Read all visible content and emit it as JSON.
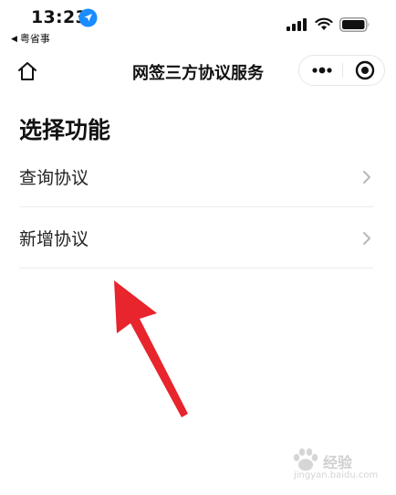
{
  "status_bar": {
    "time": "13:23",
    "back_app_label": "粤省事",
    "icons": [
      "location-arrow-icon",
      "cellular-signal-icon",
      "wifi-icon",
      "battery-icon"
    ]
  },
  "nav_bar": {
    "title": "网签三方协议服务",
    "icons": [
      "home-icon",
      "more-dots-icon",
      "close-miniprogram-icon"
    ]
  },
  "main": {
    "section_title": "选择功能",
    "items": [
      {
        "label": "查询协议"
      },
      {
        "label": "新增协议"
      }
    ]
  },
  "annotation": {
    "arrow_color": "#e8242c",
    "points_to": "新增协议"
  },
  "watermark": {
    "text": "经验",
    "subtext": "jingyan.baidu.com"
  },
  "colors": {
    "accent_blue": "#1a8cff",
    "arrow_red": "#e8242c",
    "divider": "#ececec",
    "chevron": "#b8b8b8"
  }
}
